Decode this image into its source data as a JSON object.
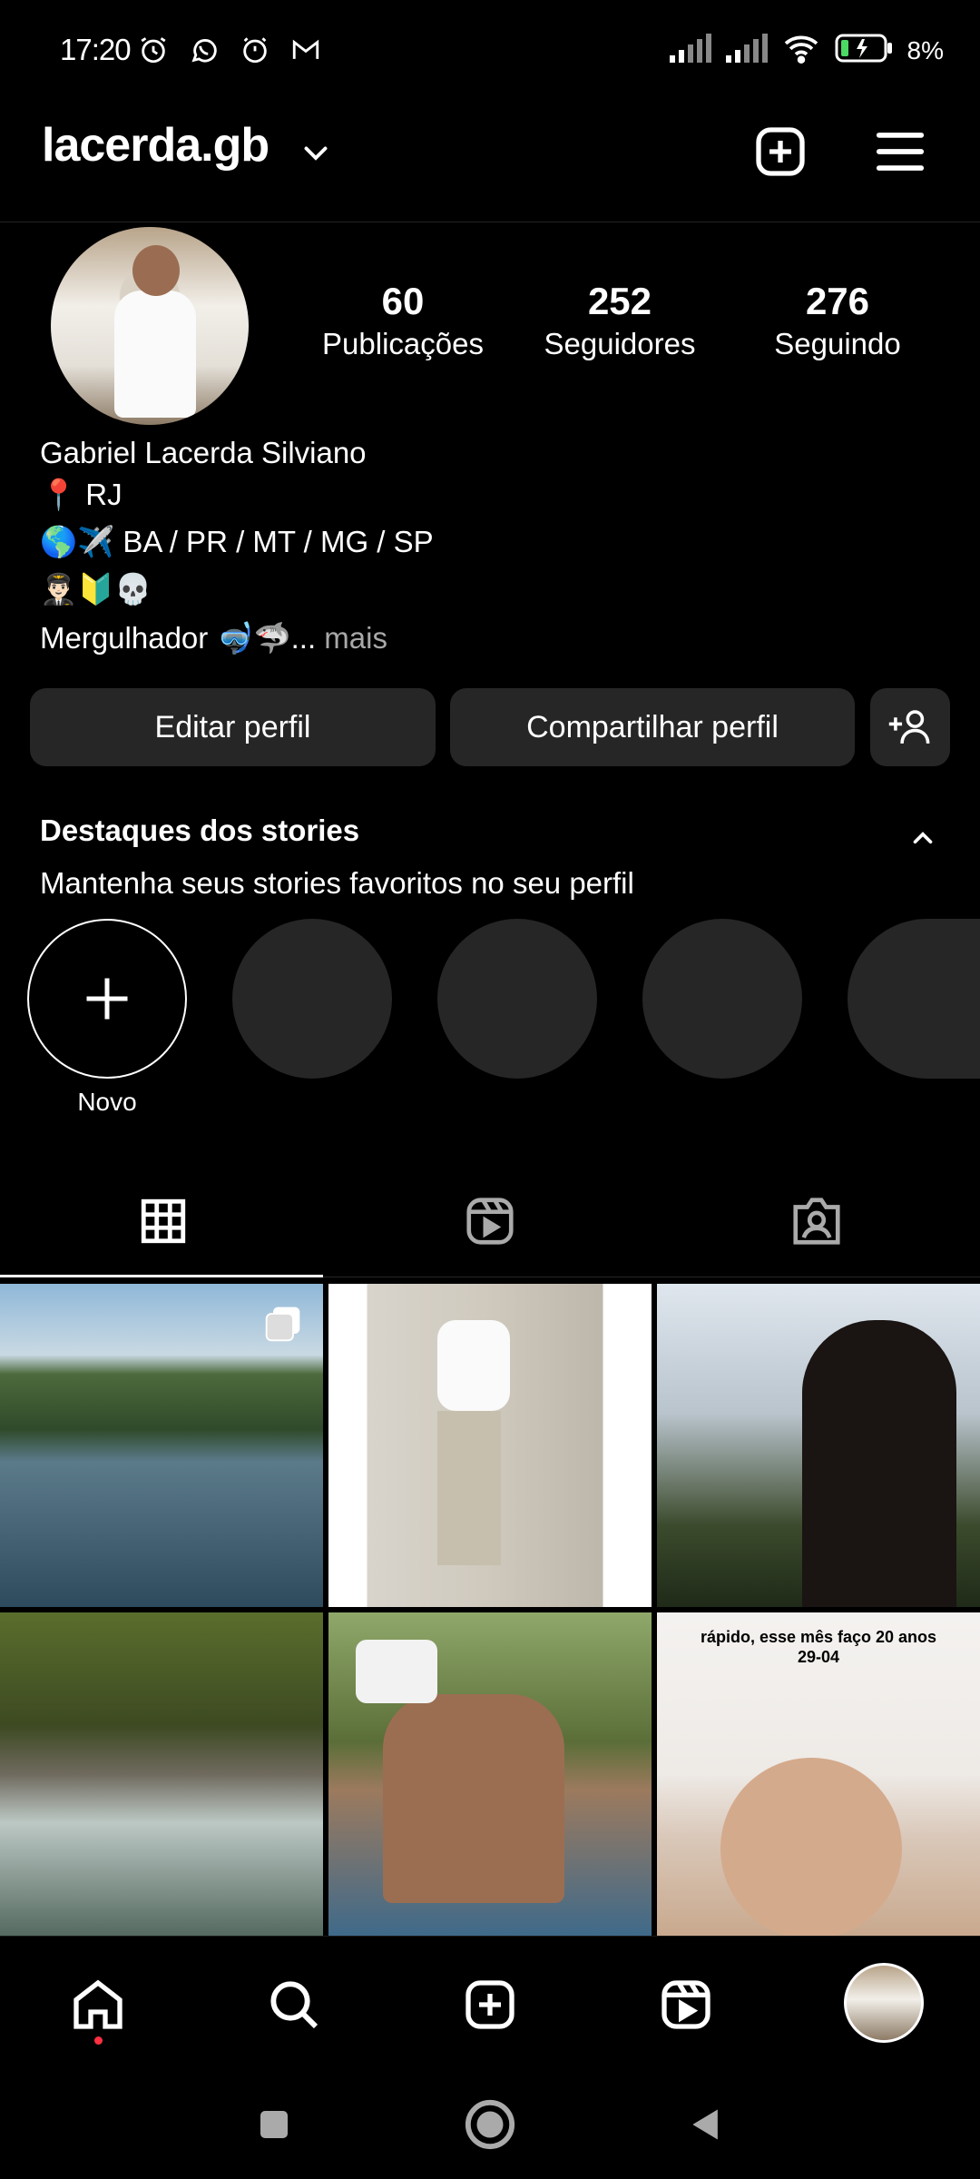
{
  "status_bar": {
    "time": "17:20",
    "battery": "8%",
    "left_icons": [
      "alarm-icon",
      "whatsapp-icon",
      "clock-icon",
      "gmail-icon"
    ],
    "right_icons": [
      "signal-icon",
      "signal-icon",
      "wifi-icon",
      "battery-icon"
    ]
  },
  "header": {
    "username": "lacerda.gb",
    "icons": [
      "chevron-down-icon",
      "create-icon",
      "menu-icon"
    ]
  },
  "profile": {
    "stats": [
      {
        "value": "60",
        "label": "Publicações"
      },
      {
        "value": "252",
        "label": "Seguidores"
      },
      {
        "value": "276",
        "label": "Seguindo"
      }
    ],
    "name": "Gabriel Lacerda Silviano",
    "bio_lines": [
      "📍 RJ",
      "🌎✈️ BA / PR / MT / MG / SP",
      "👨🏻‍✈️🔰💀"
    ],
    "bio_last": "Mergulhador 🤿🦈...",
    "more_label": "mais"
  },
  "actions": {
    "edit_label": "Editar perfil",
    "share_label": "Compartilhar perfil"
  },
  "highlights": {
    "title": "Destaques dos stories",
    "subtitle": "Mantenha seus stories favoritos no seu perfil",
    "new_label": "Novo"
  },
  "tabs": [
    "grid-icon",
    "reels-icon",
    "tagged-icon"
  ],
  "grid": {
    "caption_6": "rápido, esse mês faço 20 anos\n29-04"
  },
  "colors": {
    "background": "#000000",
    "button_bg": "#262626",
    "muted_text": "#a8a8a8",
    "notification_dot": "#ff3040"
  }
}
